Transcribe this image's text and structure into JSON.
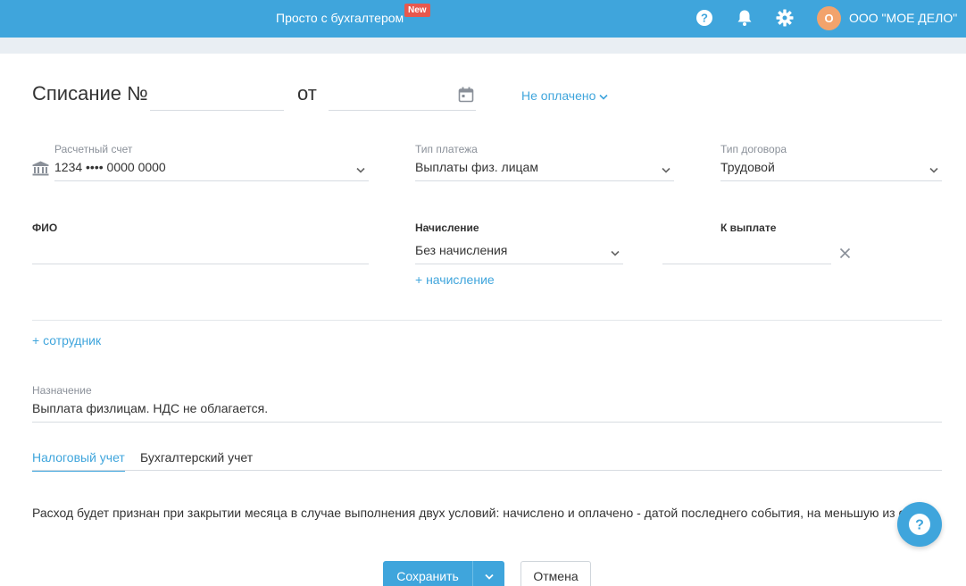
{
  "header": {
    "brand": "Просто с бухгалтером",
    "new_badge": "New",
    "company": "ООО \"МОЕ ДЕЛО\"",
    "avatar_letter": "О",
    "icons": [
      "help-icon",
      "bell-icon",
      "gear-icon"
    ]
  },
  "document": {
    "title": "Списание №",
    "number": "",
    "from_label": "от",
    "date": "",
    "status": "Не оплачено"
  },
  "fields": {
    "account": {
      "label": "Расчетный счет",
      "value": "1234 •••• 0000 0000"
    },
    "payment_type": {
      "label": "Тип платежа",
      "value": "Выплаты физ. лицам"
    },
    "contract_type": {
      "label": "Тип договора",
      "value": "Трудовой"
    },
    "fio": {
      "label": "ФИО",
      "value": ""
    },
    "accrual": {
      "label": "Начисление",
      "value": "Без начисления",
      "add_link": "+ начисление"
    },
    "to_pay": {
      "label": "К выплате",
      "value": ""
    }
  },
  "add_employee": "+ сотрудник",
  "purpose": {
    "label": "Назначение",
    "value": "Выплата физлицам. НДС не облагается."
  },
  "tabs": [
    {
      "label": "Налоговый учет",
      "active": true
    },
    {
      "label": "Бухгалтерский учет",
      "active": false
    }
  ],
  "note": "Расход будет признан при закрытии месяца в случае выполнения двух условий: начислено и оплачено - датой последнего события, на меньшую из сумм.",
  "actions": {
    "save": "Сохранить",
    "cancel": "Отмена"
  },
  "colors": {
    "accent": "#3fa5dc",
    "badge": "#e8584d",
    "avatar": "#f2a36c"
  }
}
